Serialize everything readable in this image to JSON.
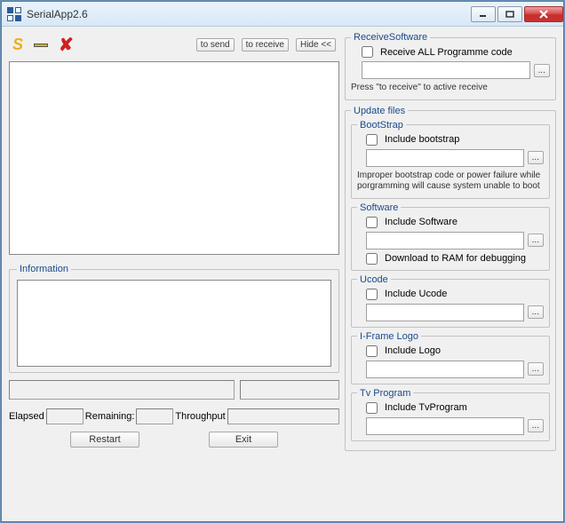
{
  "title": "SerialApp2.6",
  "toolbar": {
    "to_send": "to send",
    "to_receive": "to receive",
    "hide": "Hide <<"
  },
  "information": {
    "legend": "Information"
  },
  "stats": {
    "elapsed_label": "Elapsed",
    "remaining_label": "Remaining:",
    "throughput_label": "Throughput"
  },
  "bottom": {
    "restart": "Restart",
    "exit": "Exit"
  },
  "receive": {
    "legend": "ReceiveSoftware",
    "cb_label": "Receive ALL Programme code",
    "note": "Press \"to receive\"  to active receive",
    "path": "",
    "browse": "..."
  },
  "update": {
    "legend": "Update files",
    "bootstrap": {
      "legend": "BootStrap",
      "cb_label": "Include bootstrap",
      "note": "Improper bootstrap code or power failure while porgramming will cause system unable to boot",
      "path": "",
      "browse": "..."
    },
    "software": {
      "legend": "Software",
      "cb_label": "Include Software",
      "dbg_label": "Download to RAM for debugging",
      "path": "",
      "browse": "..."
    },
    "ucode": {
      "legend": "Ucode",
      "cb_label": "Include Ucode",
      "path": "",
      "browse": "..."
    },
    "iframe": {
      "legend": "I-Frame Logo",
      "cb_label": "Include Logo",
      "path": "",
      "browse": "..."
    },
    "tv": {
      "legend": "Tv Program",
      "cb_label": "Include TvProgram",
      "path": "",
      "browse": "..."
    }
  }
}
